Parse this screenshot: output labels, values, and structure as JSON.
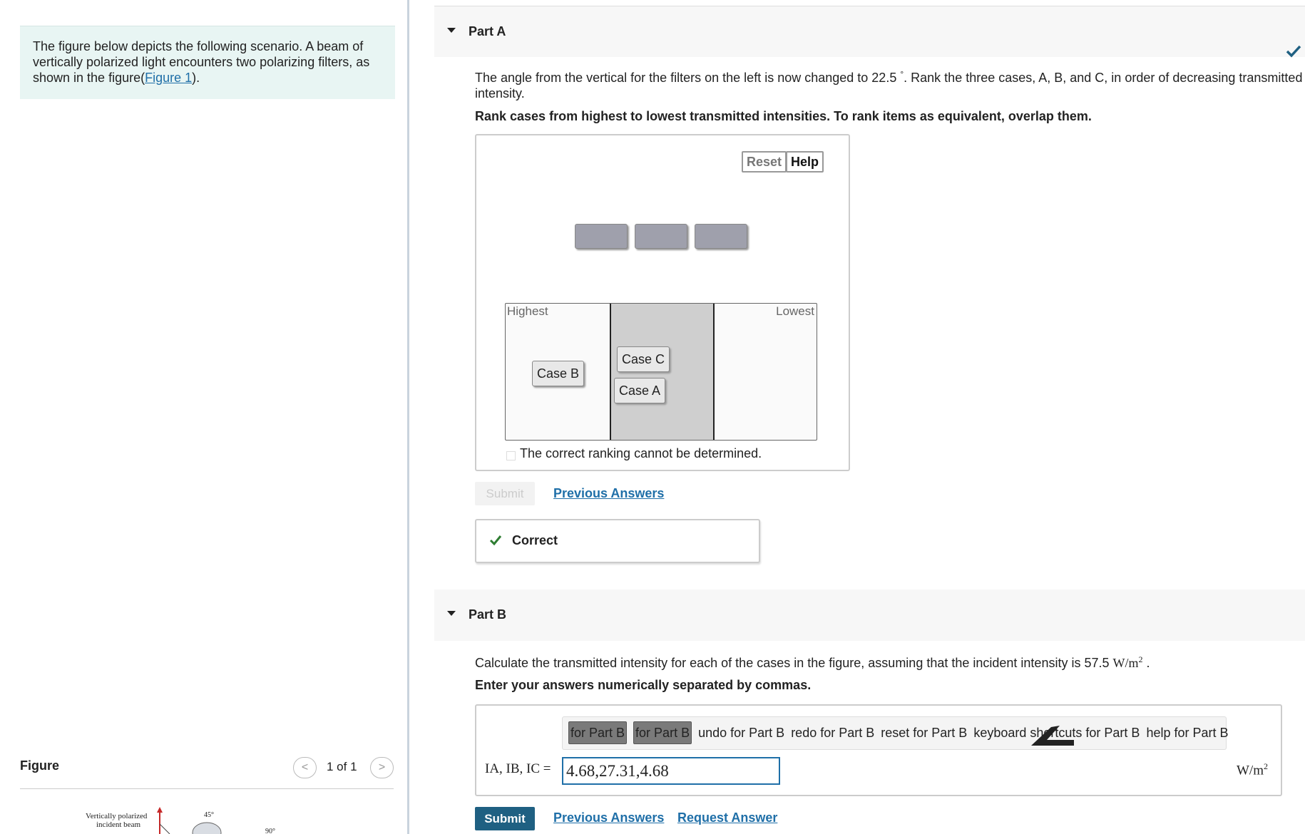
{
  "intro": {
    "text_before": "The figure below depicts the following scenario. A beam of vertically polarized light encounters two polarizing filters, as shown in the figure(",
    "link": "Figure 1",
    "text_after": ")."
  },
  "figure_panel": {
    "title": "Figure",
    "prev": "<",
    "next": ">",
    "pager": "1 of 1",
    "img_label1": "Vertically polarized",
    "img_label2": "incident beam",
    "img_angle1": "45°",
    "img_angle2": "90°"
  },
  "partA": {
    "title": "Part A",
    "question_a": "The angle from the vertical for the filters on the left is now changed to 22.5",
    "question_deg": "°",
    "question_b": ". Rank the three cases, A, B, and C, in order of decreasing transmitted intensity.",
    "instruction": "Rank cases from highest to lowest transmitted intensities. To rank items as equivalent, overlap them.",
    "reset_label": "Reset",
    "help_label": "Help",
    "highest_label": "Highest",
    "lowest_label": "Lowest",
    "tiles": {
      "caseB": "Case B",
      "caseC": "Case C",
      "caseA": "Case A"
    },
    "cannot_label": "The correct ranking cannot be determined.",
    "submit_label": "Submit",
    "previous_answers": "Previous Answers",
    "feedback": "Correct"
  },
  "partB": {
    "title": "Part B",
    "question_a": "Calculate the transmitted intensity for each of the cases in the figure, assuming that the incident intensity is 57.5",
    "question_unit": "W/m",
    "question_unit_exp": "2",
    "question_end": ".",
    "instruction": "Enter your answers numerically separated by commas.",
    "toolbar": [
      "for Part B",
      "for Part B",
      "undo for Part B",
      "redo for Part B",
      "reset for Part B",
      "keyboard shortcuts for Part B",
      "help for Part B"
    ],
    "answer_label": "IA, IB, IC =",
    "answer_value": "4.68,27.31,4.68",
    "unit": "W/m",
    "unit_exp": "2",
    "submit_label": "Submit",
    "previous_answers": "Previous Answers",
    "request_answer": "Request Answer"
  },
  "colors": {
    "link": "#1f6fa8",
    "success": "#2e7d32",
    "submit": "#1f6082"
  },
  "icons": {
    "partA_status": "check-icon",
    "feedback": "check-icon",
    "caret": "caret-down-icon"
  }
}
